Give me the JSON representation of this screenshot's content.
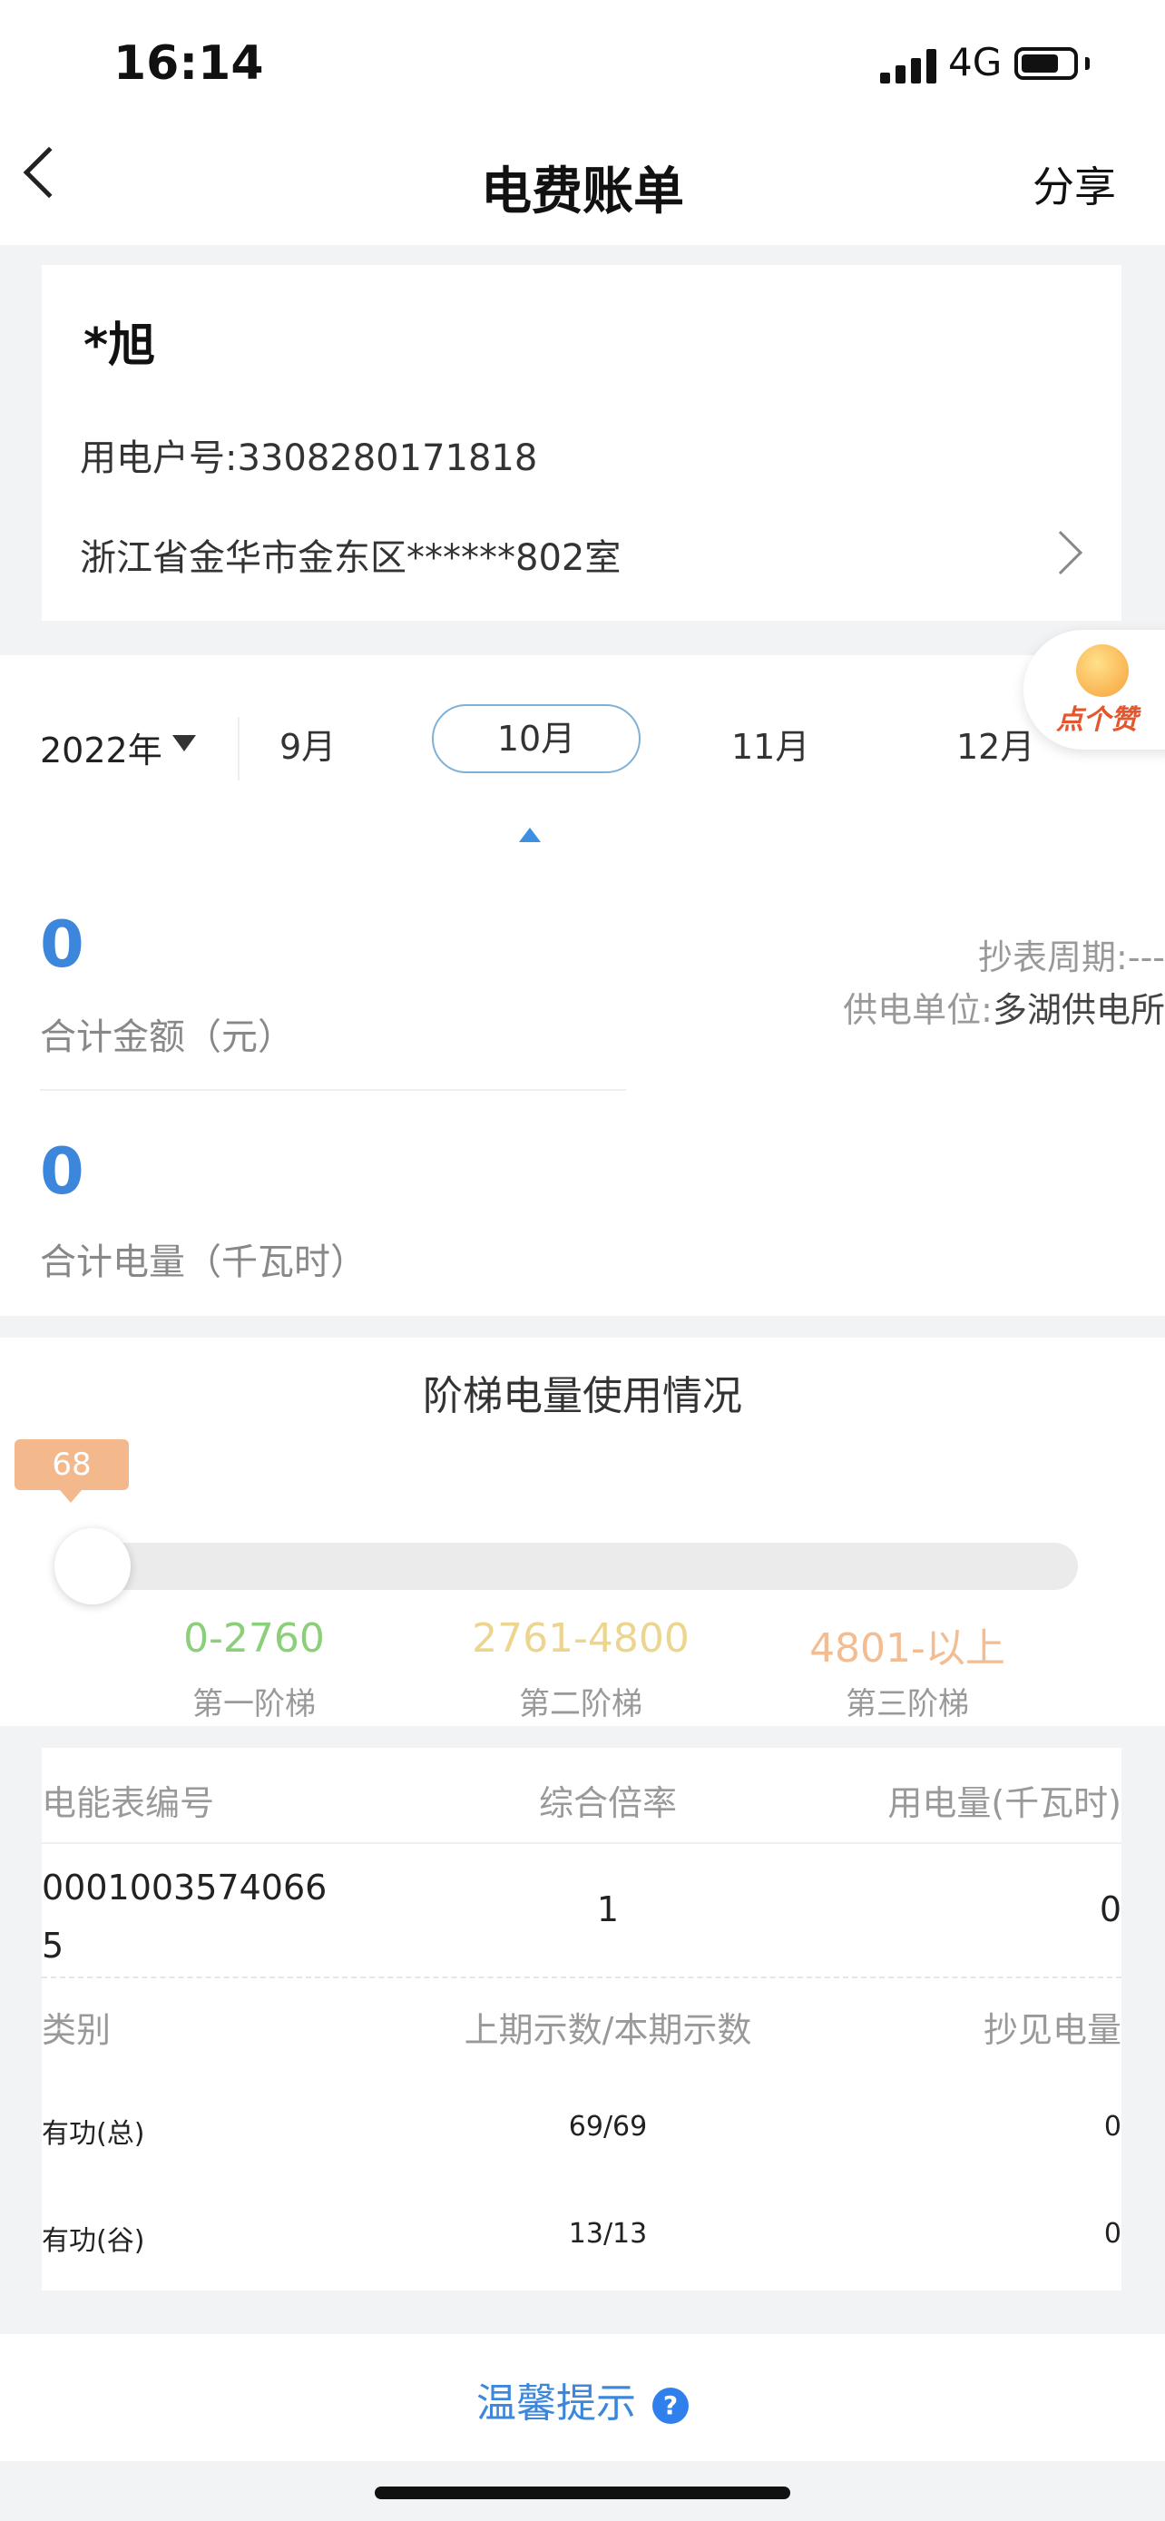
{
  "status": {
    "time": "16:14",
    "network": "4G"
  },
  "nav": {
    "title": "电费账单",
    "share": "分享"
  },
  "account": {
    "name": "*旭",
    "account_no": "用电户号:3308280171818",
    "address": "浙江省金华市金东区******802室"
  },
  "months": {
    "year": "2022年",
    "items": [
      "9月",
      "10月",
      "11月",
      "12月"
    ],
    "selected": "10月"
  },
  "like": {
    "label": "点个赞"
  },
  "summary": {
    "amount": "0",
    "amount_label": "合计金额（元）",
    "kwh": "0",
    "kwh_label": "合计电量（千瓦时）",
    "period_label": "抄表周期:",
    "period_value": "---",
    "unit_label": "供电单位:",
    "unit_value": "多湖供电所"
  },
  "tiers": {
    "title": "阶梯电量使用情况",
    "current": "68",
    "items": [
      {
        "range": "0-2760",
        "name": "第一阶梯",
        "color": "#8ccf7a"
      },
      {
        "range": "2761-4800",
        "name": "第二阶梯",
        "color": "#ecd58f"
      },
      {
        "range": "4801-以上",
        "name": "第三阶梯",
        "color": "#f2bd92"
      }
    ]
  },
  "meter": {
    "headers": [
      "电能表编号",
      "综合倍率",
      "用电量(千瓦时)"
    ],
    "row": {
      "meter_no": "00010035740665",
      "rate": "1",
      "usage": "0"
    },
    "reading_headers": [
      "类别",
      "上期示数/本期示数",
      "抄见电量"
    ],
    "readings": [
      {
        "type": "有功(总)",
        "values": "69/69",
        "usage": "0"
      },
      {
        "type": "有功(谷)",
        "values": "13/13",
        "usage": "0"
      }
    ]
  },
  "tip": {
    "label": "温馨提示",
    "icon": "?"
  }
}
